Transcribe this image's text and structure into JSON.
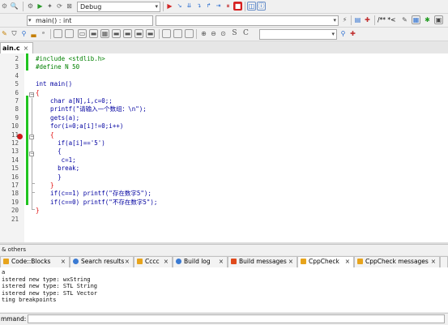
{
  "toolbar": {
    "build_target": "Debug",
    "scope_combo": "main() : int",
    "comment_label": "/** *<",
    "search_combo_value": "",
    "letter_s": "S",
    "letter_c": "C"
  },
  "editor": {
    "file_tab": "ain.c",
    "file_tab_close": "×",
    "lines": [
      {
        "n": "2",
        "text": "#include <stdlib.h>"
      },
      {
        "n": "3",
        "text": "#define N 50"
      },
      {
        "n": "4",
        "text": ""
      },
      {
        "n": "5",
        "text": "int main()"
      },
      {
        "n": "6",
        "text": "{"
      },
      {
        "n": "7",
        "text": "    char a[N],i,c=0;;"
      },
      {
        "n": "8",
        "text": "    printf(\"请输入一个数组：\\n\");"
      },
      {
        "n": "9",
        "text": "    gets(a);"
      },
      {
        "n": "10",
        "text": "    for(i=0;a[i]!=0;i++)"
      },
      {
        "n": "11",
        "text": "    {"
      },
      {
        "n": "12",
        "text": "      if(a[i]=='5')"
      },
      {
        "n": "13",
        "text": "      {"
      },
      {
        "n": "14",
        "text": "       c=1;"
      },
      {
        "n": "15",
        "text": "      break;"
      },
      {
        "n": "16",
        "text": "      }"
      },
      {
        "n": "17",
        "text": "    }"
      },
      {
        "n": "18",
        "text": "    if(c==1) printf(\"存在数字5\");"
      },
      {
        "n": "19",
        "text": "    if(c==0) printf(\"不存在数字5\");"
      },
      {
        "n": "20",
        "text": "}"
      },
      {
        "n": "21",
        "text": ""
      }
    ]
  },
  "logs": {
    "title": "& others",
    "tabs": [
      {
        "label": "Code::Blocks",
        "icon_color": "#e7a41c",
        "close": "×"
      },
      {
        "label": "Search results",
        "icon_color": "#3b7bd3",
        "close": "×"
      },
      {
        "label": "Cccc",
        "icon_color": "#e7a41c",
        "close": "×"
      },
      {
        "label": "Build log",
        "icon_color": "#3b7bd3",
        "close": "×"
      },
      {
        "label": "Build messages",
        "icon_color": "#e04a1c",
        "close": "×"
      },
      {
        "label": "CppCheck",
        "icon_color": "#e7a41c",
        "close": "×"
      },
      {
        "label": "CppCheck messages",
        "icon_color": "#e7a41c",
        "close": "×"
      }
    ],
    "lines": [
      "a",
      "istered new type: wxString",
      "istered new type: STL String",
      "istered new type: STL Vector",
      "ting breakpoints"
    ],
    "command_label": "mmand:"
  }
}
